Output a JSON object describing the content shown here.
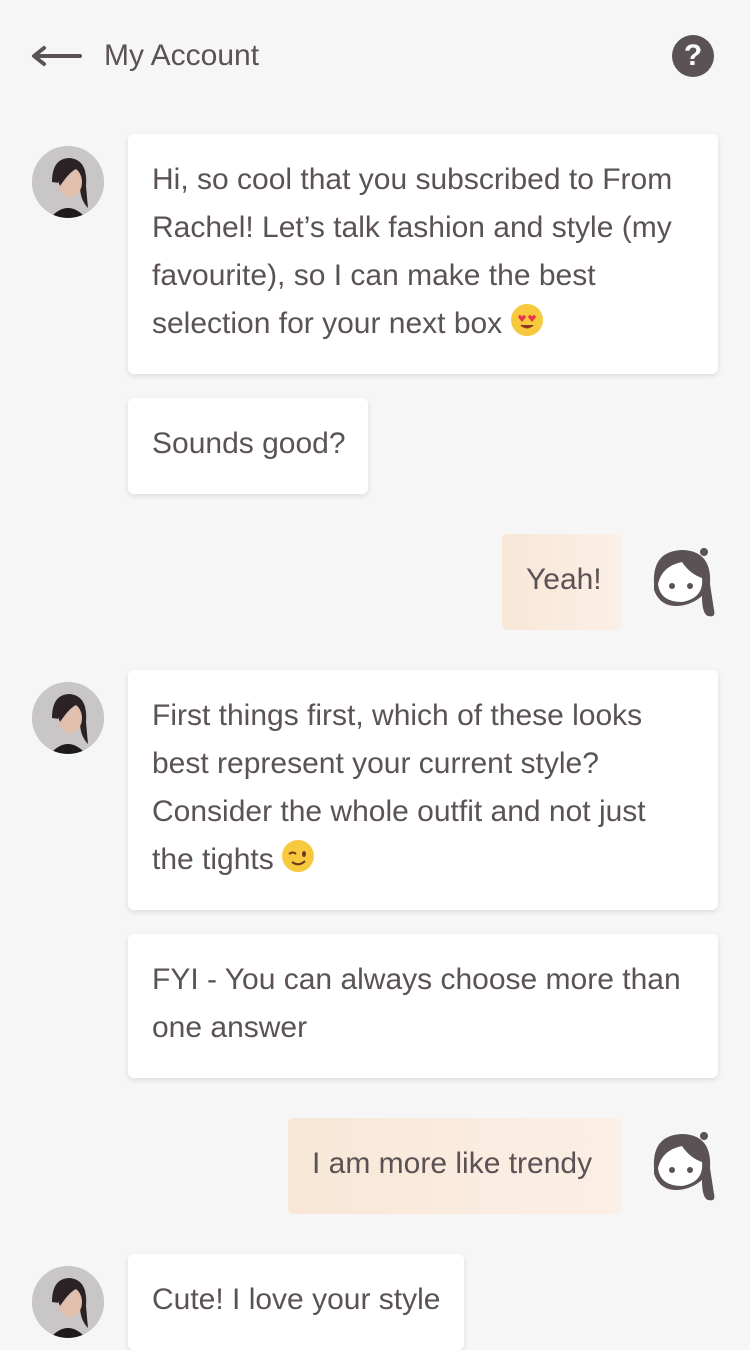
{
  "header": {
    "title": "My Account",
    "back_icon": "back-arrow-icon",
    "help_icon": "?"
  },
  "messages": [
    {
      "sender": "bot",
      "lines": [
        "Hi, so cool that you subscribed to From",
        "Rachel! Let’s talk fashion and style (my",
        "favourite), so I can make the best",
        "selection for your next box"
      ],
      "emoji": "heart-eyes-emoji"
    },
    {
      "sender": "bot",
      "lines": [
        "Sounds good?"
      ]
    },
    {
      "sender": "user",
      "lines": [
        "Yeah!"
      ]
    },
    {
      "sender": "bot",
      "lines": [
        "First things first, which of these looks",
        "best represent your current style?",
        "Consider the whole outfit and not just",
        "the tights"
      ],
      "emoji": "wink-emoji"
    },
    {
      "sender": "bot",
      "lines": [
        "FYI - You can always choose more than",
        "one answer"
      ]
    },
    {
      "sender": "user",
      "lines": [
        "I am more like trendy"
      ]
    },
    {
      "sender": "bot",
      "lines": [
        "Cute! I love your style"
      ]
    }
  ],
  "colors": {
    "background": "#f6f6f6",
    "text": "#5a5255",
    "user_bubble": "#f8e7d7",
    "bot_bubble": "#ffffff"
  }
}
